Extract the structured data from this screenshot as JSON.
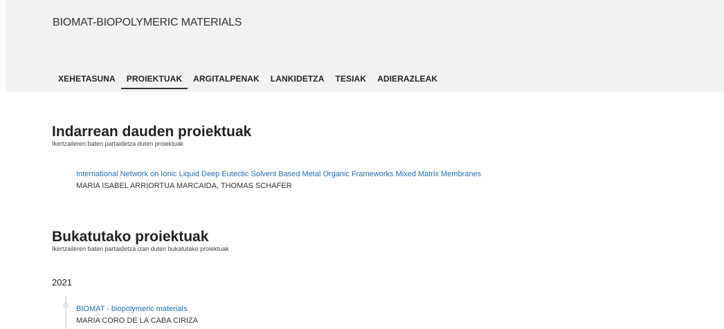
{
  "group": {
    "title": "BIOMAT-BIOPOLYMERIC MATERIALS"
  },
  "tabs": [
    {
      "label": "XEHETASUNA",
      "active": false
    },
    {
      "label": "PROIEKTUAK",
      "active": true
    },
    {
      "label": "ARGITALPENAK",
      "active": false
    },
    {
      "label": "LANKIDETZA",
      "active": false
    },
    {
      "label": "TESIAK",
      "active": false
    },
    {
      "label": "ADIERAZLEAK",
      "active": false
    }
  ],
  "current_projects": {
    "title": "Indarrean dauden proiektuak",
    "subtitle": "Ikertzaileren baten partaidetza duten proiektuak",
    "items": [
      {
        "title": "International Network on Ionic Liquid Deep Eutectic Solvent Based Metal Organic Frameworks Mixed Matrix Membranes",
        "members": "MARIA ISABEL ARRIORTUA MARCAIDA, THOMAS SCHAFER"
      }
    ]
  },
  "finished_projects": {
    "title": "Bukatutako proiektuak",
    "subtitle": "Ikertzaileren baten partaidetza izan duten bukatutako proiektuak",
    "years": [
      {
        "year": "2021",
        "items": [
          {
            "title": "BIOMAT - biopolymeric materials",
            "members": "MARIA CORO DE LA CABA CIRIZA"
          }
        ]
      }
    ]
  },
  "colors": {
    "link": "#1f6fb5",
    "header_bg": "#f2f2f2",
    "timeline": "#e2e2e2"
  }
}
